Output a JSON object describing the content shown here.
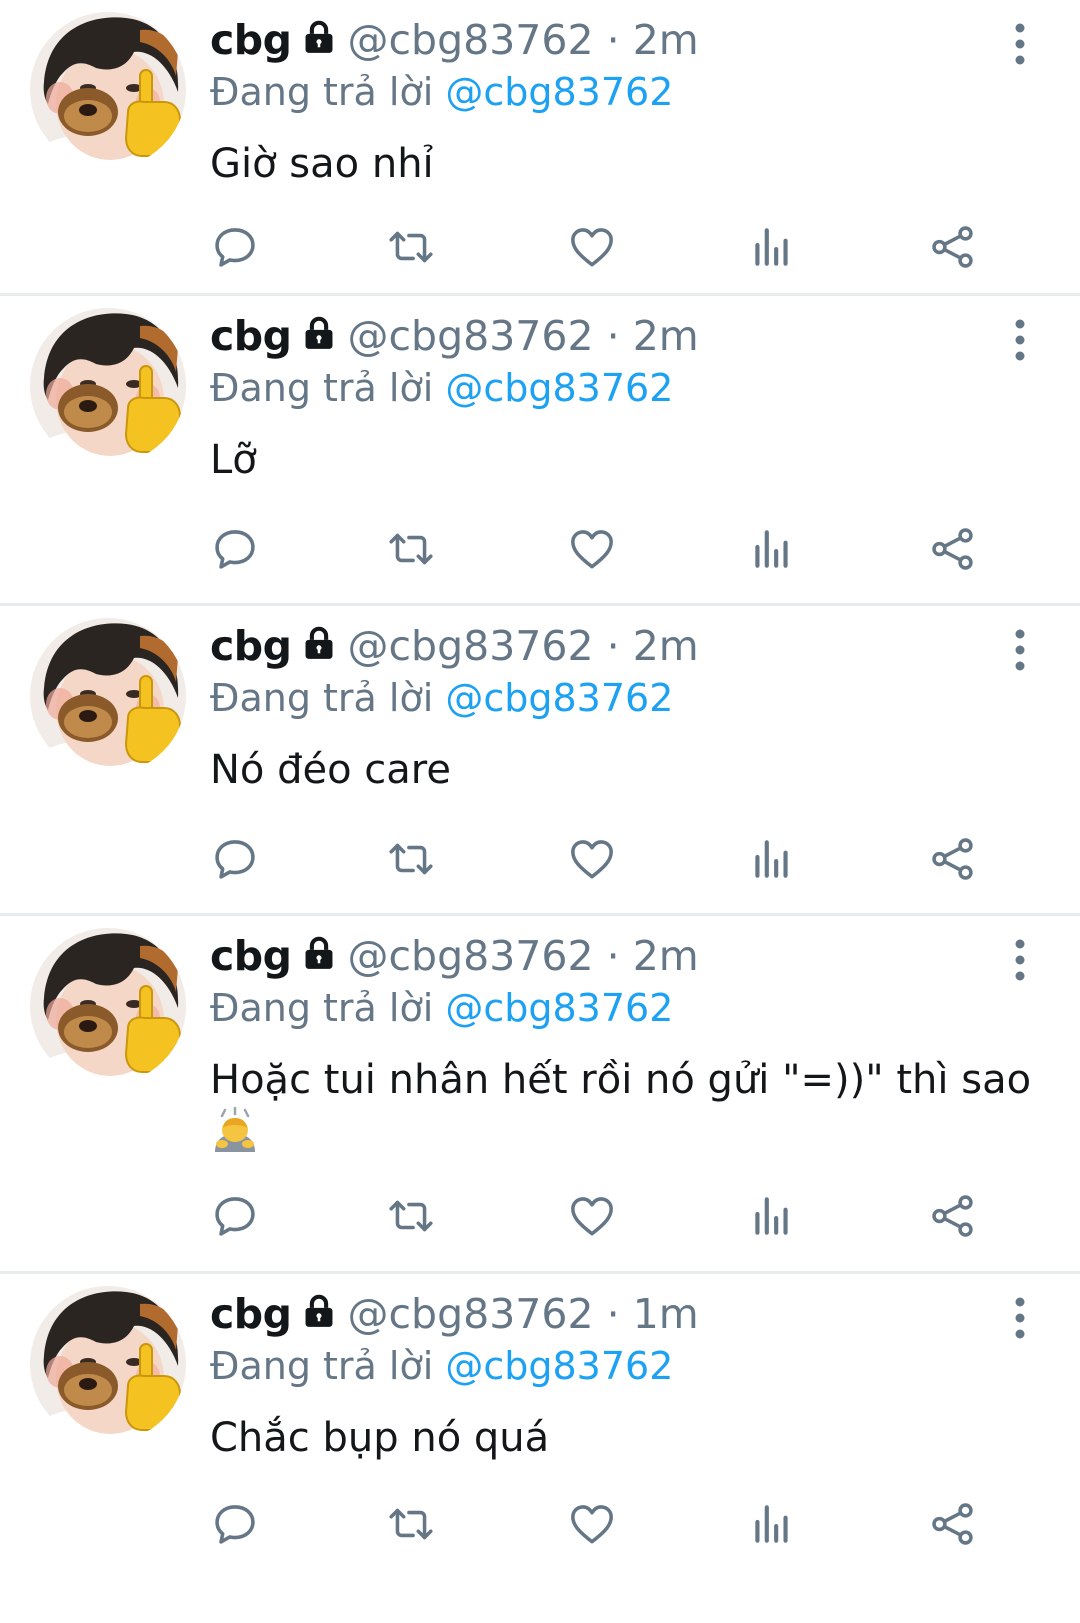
{
  "colors": {
    "accent": "#1da1f2",
    "muted": "#657786",
    "text": "#14171a",
    "divider": "#e6ecf0"
  },
  "icons": [
    "lock-icon",
    "more-icon",
    "reply-icon",
    "retweet-icon",
    "like-icon",
    "analytics-icon",
    "share-icon"
  ],
  "tweets": [
    {
      "name": "cbg",
      "handle": "@cbg83762",
      "separator": "·",
      "time": "2m",
      "reply_prefix": "Đang trả lời",
      "reply_to": "@cbg83762",
      "text": "Giờ sao nhỉ"
    },
    {
      "name": "cbg",
      "handle": "@cbg83762",
      "separator": "·",
      "time": "2m",
      "reply_prefix": "Đang trả lời",
      "reply_to": "@cbg83762",
      "text": "Lỡ"
    },
    {
      "name": "cbg",
      "handle": "@cbg83762",
      "separator": "·",
      "time": "2m",
      "reply_prefix": "Đang trả lời",
      "reply_to": "@cbg83762",
      "text": "Nó đéo care"
    },
    {
      "name": "cbg",
      "handle": "@cbg83762",
      "separator": "·",
      "time": "2m",
      "reply_prefix": "Đang trả lời",
      "reply_to": "@cbg83762",
      "text": "Hoặc tui nhân hết rồi nó gửi \"=))\" thì sao",
      "emoji": "person-bowing-emoji"
    },
    {
      "name": "cbg",
      "handle": "@cbg83762",
      "separator": "·",
      "time": "1m",
      "reply_prefix": "Đang trả lời",
      "reply_to": "@cbg83762",
      "text": "Chắc bụp nó quá"
    }
  ]
}
